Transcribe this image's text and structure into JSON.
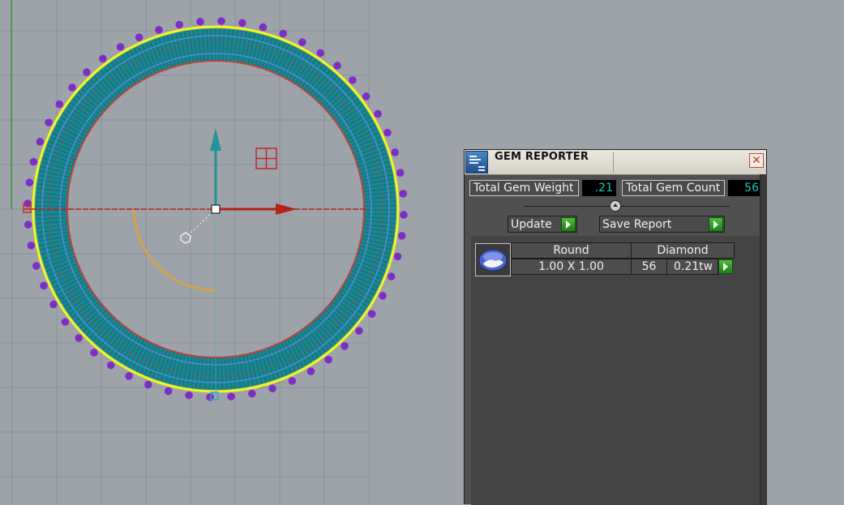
{
  "gem_reporter": {
    "title": "GEM REPORTER",
    "close_symbol": "✕",
    "total_weight_label": "Total Gem Weight",
    "total_weight_value": ".21",
    "total_count_label": "Total Gem Count",
    "total_count_value": "56",
    "update_label": "Update",
    "save_report_label": "Save Report",
    "list_header": {
      "shape": "Round",
      "material": "Diamond"
    },
    "list_row": {
      "size": "1.00 X 1.00",
      "count": "56",
      "weight": "0.21tw"
    }
  },
  "viewport": {
    "background": "#9ea3aa",
    "grid_color": "#8b9099",
    "x_axis_color": "#b2231a",
    "y_axis_color": "#22939a",
    "ring_outline_color": "#f5f51e",
    "ring_body_color": "#128e84",
    "gem_prong_color": "#7d2fc4",
    "rotation_arc_color": "#e0a528",
    "gem_count": 56
  },
  "icons": {
    "app": "gem-reporter-icon",
    "close": "close-icon",
    "go": "play-arrow-icon",
    "gem": "round-gem-icon"
  }
}
